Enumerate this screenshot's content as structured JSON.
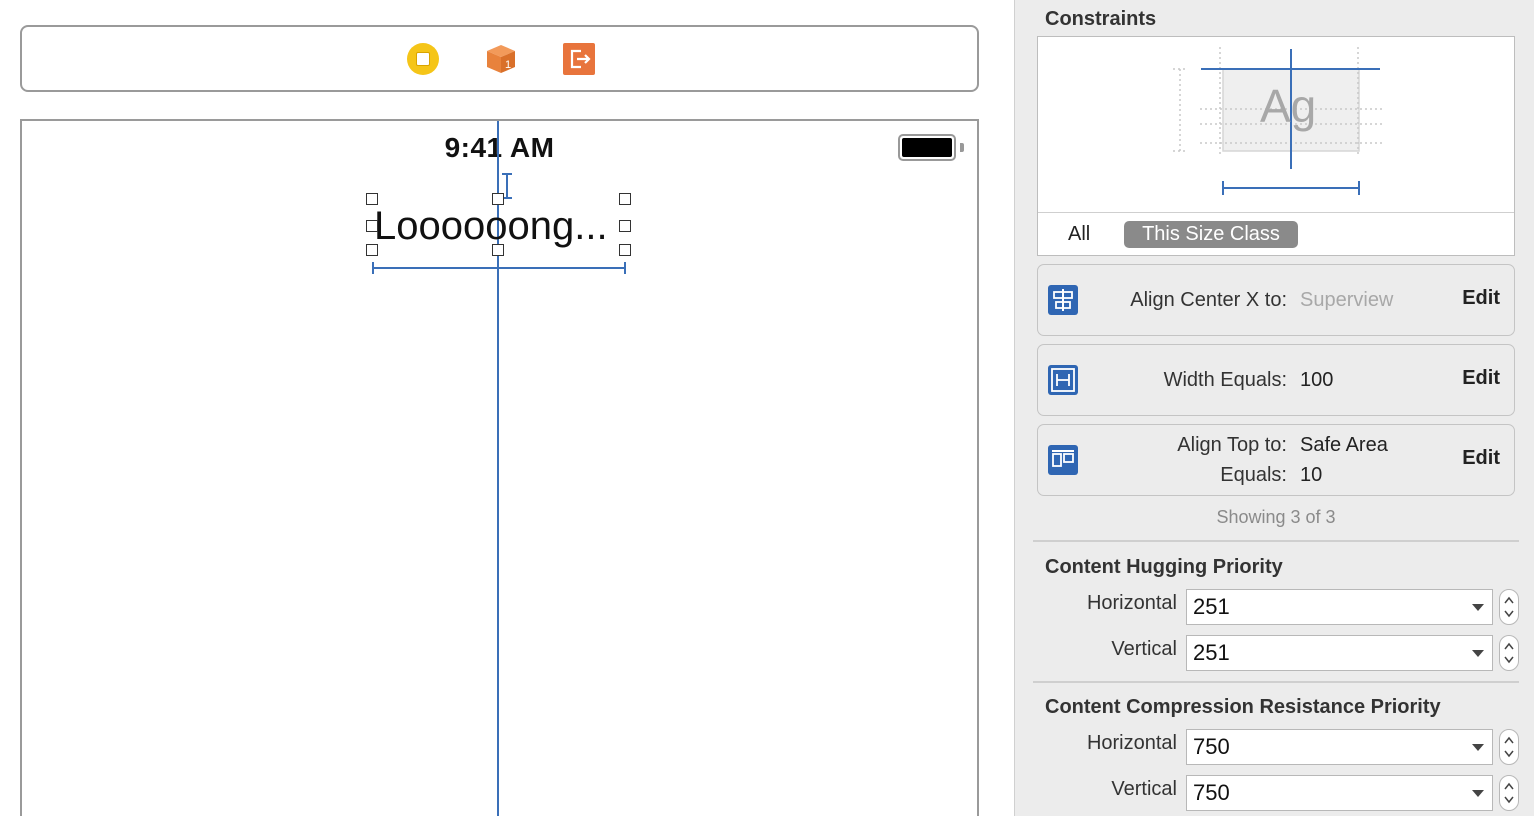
{
  "scene_bar": {
    "icons": [
      "view-controller-icon",
      "first-responder-icon",
      "exit-icon"
    ],
    "colors": {
      "view_controller": "#F5C518",
      "first_responder": "#E8823C",
      "exit": "#E8743C"
    }
  },
  "device": {
    "status_time": "9:41 AM",
    "label_text": "Loooooong..."
  },
  "inspector": {
    "constraints_title": "Constraints",
    "preview_text": "Ag",
    "tabs": {
      "all": "All",
      "size_class": "This Size Class"
    },
    "constraints": [
      {
        "key": "Align Center X to:",
        "value": "Superview",
        "edit": "Edit",
        "icon": "align-center-x-icon"
      },
      {
        "key": "Width Equals:",
        "value": "100",
        "edit": "Edit",
        "icon": "width-constraint-icon"
      },
      {
        "key": "Align Top to:",
        "value": "Safe Area",
        "key2": "Equals:",
        "value2": "10",
        "edit": "Edit",
        "icon": "align-top-icon"
      }
    ],
    "showing": "Showing 3 of 3",
    "hugging": {
      "title": "Content Hugging Priority",
      "horizontal_label": "Horizontal",
      "horizontal_value": "251",
      "vertical_label": "Vertical",
      "vertical_value": "251"
    },
    "compression": {
      "title": "Content Compression Resistance Priority",
      "horizontal_label": "Horizontal",
      "horizontal_value": "750",
      "vertical_label": "Vertical",
      "vertical_value": "750"
    },
    "accent": "#3A6FB8"
  }
}
